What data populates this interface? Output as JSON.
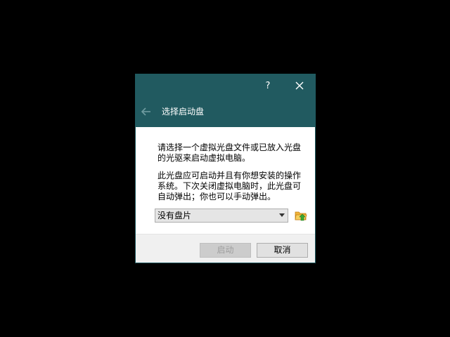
{
  "dialog": {
    "help_label": "?",
    "close_icon": "close-icon",
    "back_icon": "back-arrow-icon",
    "title": "选择启动盘",
    "paragraph1": "请选择一个虚拟光盘文件或已放入光盘的光驱来启动虚拟电脑。",
    "paragraph2": "此光盘应可启动并且有你想安装的操作系统。下次关闭虚拟电脑时，此光盘可自动弹出；你也可以手动弹出。",
    "disk_select": {
      "selected": "没有盘片"
    },
    "folder_icon": "folder-open-icon",
    "buttons": {
      "start": "启动",
      "cancel": "取消"
    },
    "colors": {
      "header": "#215a60",
      "footer": "#f0f0f0"
    }
  }
}
